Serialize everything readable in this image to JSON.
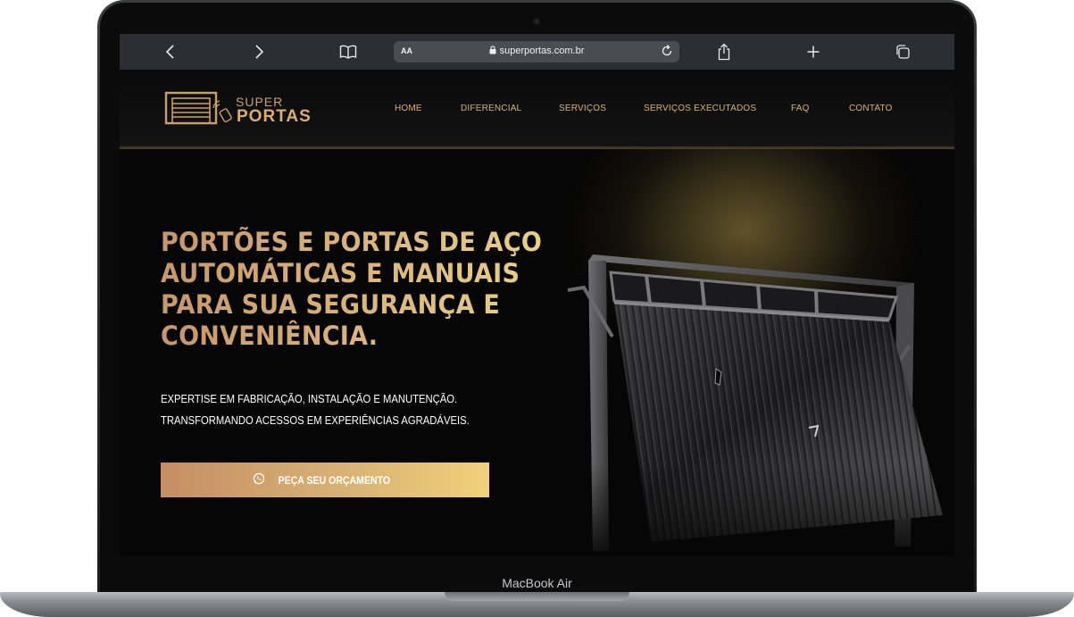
{
  "browser": {
    "url": "superportas.com.br",
    "reader_label": "AA",
    "icons": [
      "back-icon",
      "forward-icon",
      "bookmarks-icon",
      "lock-icon",
      "reload-icon",
      "share-icon",
      "new-tab-icon",
      "tabs-icon"
    ]
  },
  "site": {
    "logo": {
      "line1": "SUPER",
      "line2": "PORTAS"
    },
    "nav": [
      "HOME",
      "DIFERENCIAL",
      "SERVIÇOS",
      "SERVIÇOS EXECUTADOS",
      "FAQ",
      "CONTATO"
    ],
    "hero": {
      "title_lines": [
        "PORTÕES E PORTAS DE AÇO",
        "AUTOMÁTICAS E MANUAIS",
        "PARA SUA SEGURANÇA E",
        "CONVENIÊNCIA."
      ],
      "subtitle_lines": [
        "EXPERTISE EM FABRICAÇÃO, INSTALAÇÃO E MANUTENÇÃO.",
        "TRANSFORMANDO ACESSOS EM EXPERIÊNCIAS AGRADÁVEIS."
      ],
      "cta_label": "PEÇA SEU ORÇAMENTO",
      "cta_icon": "whatsapp-icon"
    }
  },
  "device": {
    "label": "MacBook Air"
  },
  "colors": {
    "gold": "#d9b271",
    "gold_light": "#efd17a",
    "copper": "#c58e63",
    "background": "#060606",
    "browser_bar": "#2c2e33"
  }
}
